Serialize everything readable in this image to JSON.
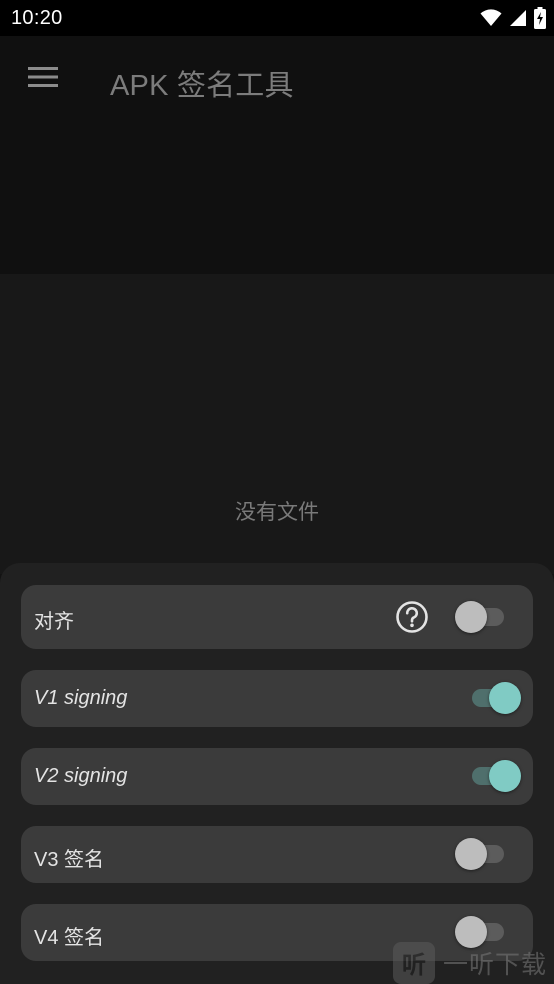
{
  "status_bar": {
    "time": "10:20",
    "icons": [
      "wifi-icon",
      "signal-icon",
      "battery-charging-icon"
    ]
  },
  "toolbar": {
    "menu_icon": "menu-icon",
    "title": "APK 签名工具"
  },
  "main": {
    "empty_text": "没有文件"
  },
  "options": [
    {
      "label": "对齐",
      "italic": false,
      "has_help": true,
      "enabled": false
    },
    {
      "label": "V1 signing",
      "italic": true,
      "has_help": false,
      "enabled": true
    },
    {
      "label": "V2 signing",
      "italic": true,
      "has_help": false,
      "enabled": true
    },
    {
      "label": "V3 签名",
      "italic": false,
      "has_help": false,
      "enabled": false
    },
    {
      "label": "V4 签名",
      "italic": false,
      "has_help": false,
      "enabled": false
    }
  ],
  "watermark": {
    "badge": "听",
    "text": "一听下载"
  },
  "colors": {
    "accent": "#80cbc4",
    "background": "#131313",
    "row": "#3b3b3b"
  }
}
